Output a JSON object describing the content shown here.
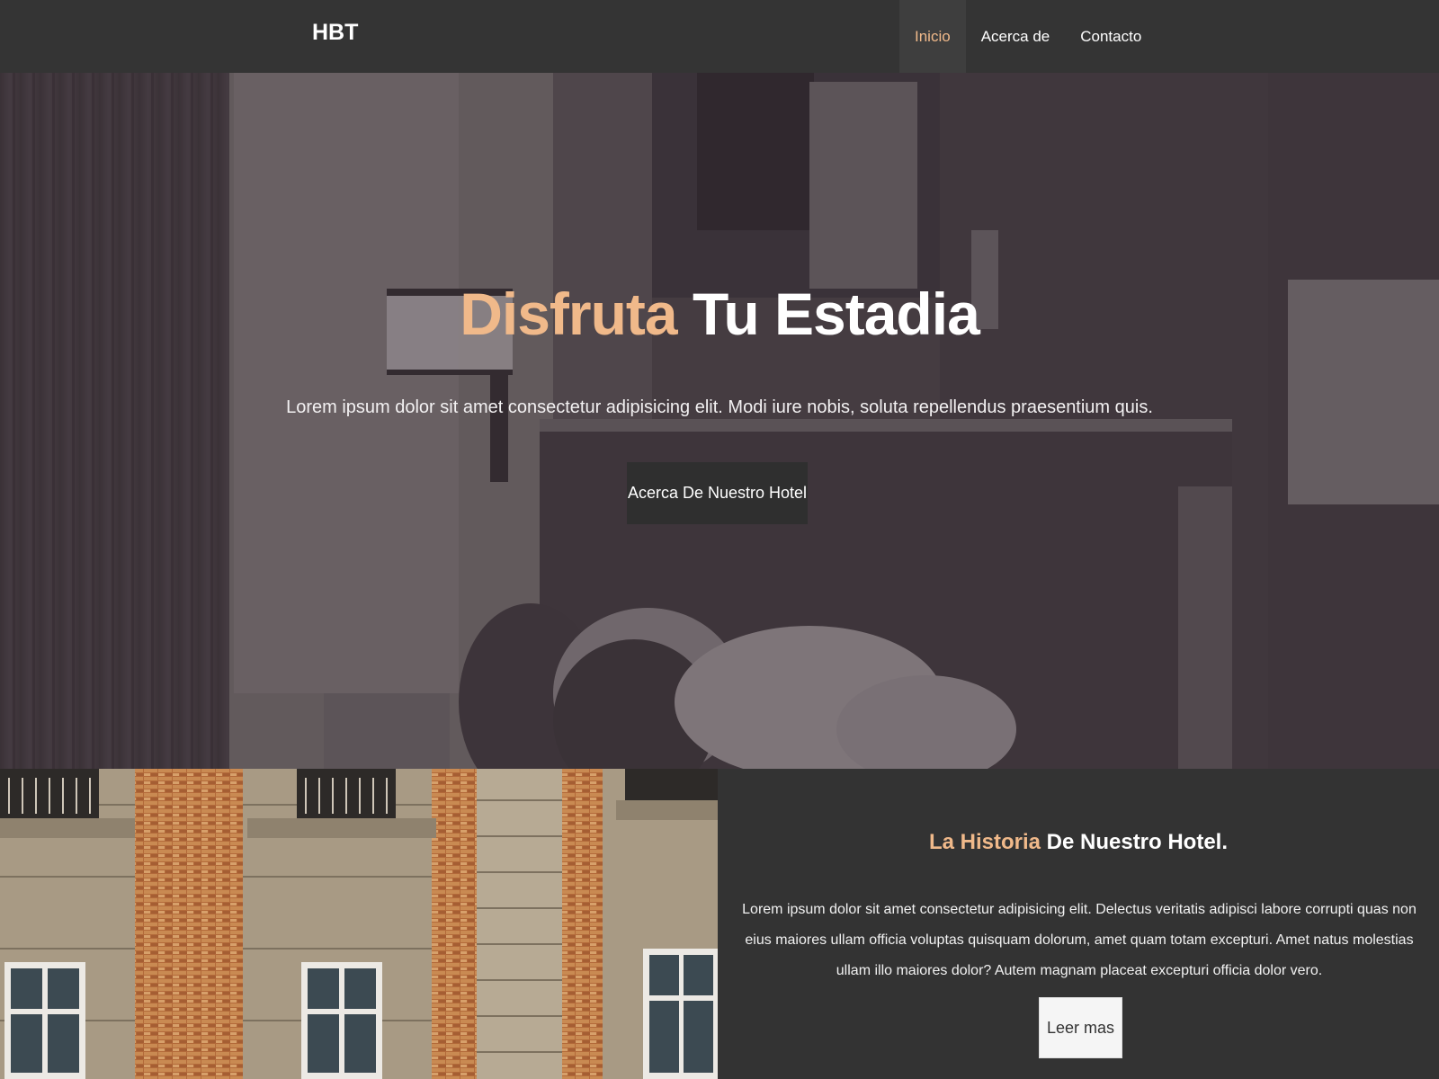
{
  "navbar": {
    "brand": "HBT",
    "links": [
      {
        "label": "Inicio",
        "active": true
      },
      {
        "label": "Acerca de",
        "active": false
      },
      {
        "label": "Contacto",
        "active": false
      }
    ]
  },
  "hero": {
    "title_accent": "Disfruta",
    "title_rest": "Tu Estadia",
    "subtitle": "Lorem ipsum dolor sit amet consectetur adipisicing elit. Modi iure nobis, soluta repellendus praesentium quis.",
    "button_label": "Acerca De Nuestro Hotel"
  },
  "history": {
    "title_accent": "La Historia",
    "title_rest": "De Nuestro Hotel.",
    "text": "Lorem ipsum dolor sit amet consectetur adipisicing elit. Delectus veritatis adipisci labore corrupti quas non eius maiores ullam officia voluptas quisquam dolorum, amet quam totam excepturi. Amet natus molestias ullam illo maiores dolor? Autem magnam placeat excepturi officia dolor vero.",
    "button_label": "Leer mas"
  },
  "colors": {
    "accent": "#f0b98a",
    "navbar_bg": "#343434",
    "panel_bg": "#333333"
  }
}
